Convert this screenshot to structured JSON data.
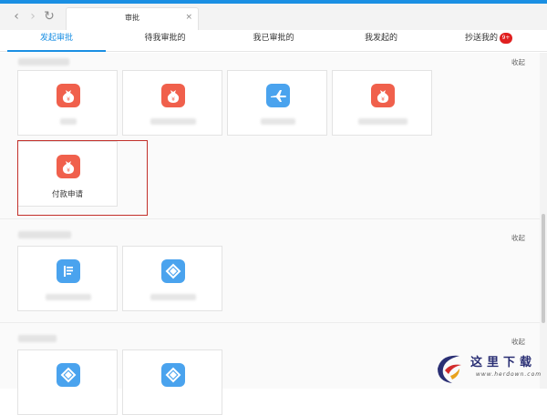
{
  "browser": {
    "tab_title": "审批",
    "tab_close": "×",
    "back": "‹",
    "forward": "›",
    "refresh": "↻"
  },
  "subtabs": [
    {
      "label": "发起审批",
      "active": true
    },
    {
      "label": "待我审批的"
    },
    {
      "label": "我已审批的"
    },
    {
      "label": "我发起的"
    },
    {
      "label": "抄送我的",
      "badge": "9+"
    }
  ],
  "sections": [
    {
      "collapse_label": "收起"
    },
    {
      "collapse_label": "收起"
    },
    {
      "collapse_label": "收起"
    }
  ],
  "cards": {
    "payment_request": "付款申请"
  },
  "icons": {
    "money_bag": "money-bag-icon",
    "airplane": "airplane-icon",
    "document_list": "document-list-icon",
    "diamond_tag": "diamond-tag-icon"
  },
  "colors": {
    "accent": "#1a8fe3",
    "icon_red": "#f0604c",
    "icon_blue": "#4aa3ee",
    "highlight_border": "#c2302a",
    "badge": "#e02020"
  },
  "watermark": {
    "text": "这里下载",
    "url": "www.herdown.com"
  }
}
